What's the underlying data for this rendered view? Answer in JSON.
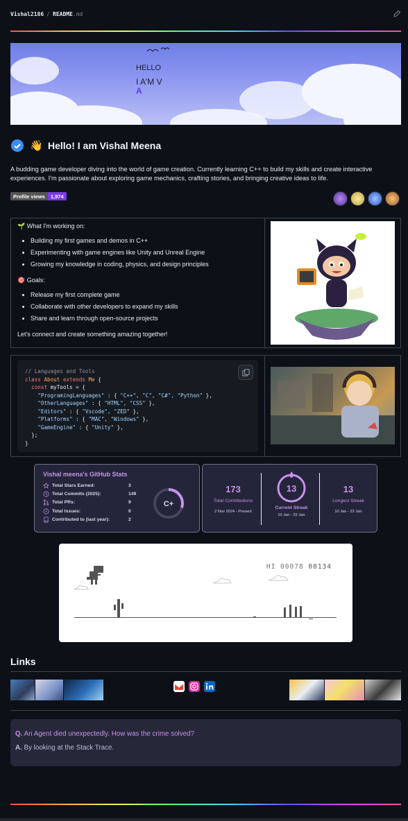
{
  "breadcrumb": {
    "repo": "Vishal2186",
    "separator": "/",
    "file": "README",
    "ext": ".md"
  },
  "banner": {
    "line1": "HELLO",
    "line2": "I A'M V",
    "cursor": "A"
  },
  "greeting": {
    "title": "Hello! I am Vishal Meena"
  },
  "intro": "A budding game developer diving into the world of game creation. Currently learning C++ to build my skills and create interactive experiences. I'm passionate about exploring game mechanics, crafting stories, and bringing creative ideas to life.",
  "profile_views": {
    "label": "Profile views",
    "count": "1,974"
  },
  "working": {
    "heading": "🌱 What I'm working on:",
    "items": [
      "Building my first games and demos in C++",
      "Experimenting with game engines like Unity and Unreal Engine",
      "Growing my knowledge in coding, physics, and design principles"
    ],
    "goals_heading": "🎯 Goals:",
    "goals": [
      "Release my first complete game",
      "Collaborate with other developers to expand my skills",
      "Share and learn through open-source projects"
    ],
    "cta": "Let's connect and create something amazing together!"
  },
  "code": {
    "comment": "// Languages and Tools",
    "kw_class": "class",
    "class_name": "About",
    "kw_extends": "extends",
    "base": "Me",
    "kw_const": "const",
    "var": "myTools",
    "rows": [
      {
        "key": "\"ProgramingLanguages\"",
        "vals": "\"C++\", \"C\", \"C#\", \"Python\""
      },
      {
        "key": "\"OtherLanguages\"",
        "vals": "\"HTML\", \"CSS\""
      },
      {
        "key": "\"Editors\"",
        "vals": "\"Vscode\", \"ZED\""
      },
      {
        "key": "\"Platforms\"",
        "vals": "\"MAC\", \"Windows\""
      },
      {
        "key": "\"GameEngine\"",
        "vals": "\"Unity\""
      }
    ]
  },
  "stats": {
    "title": "Vishal meena's GitHub Stats",
    "rows": [
      {
        "label": "Total Stars Earned:",
        "value": "3"
      },
      {
        "label": "Total Commits (2025):",
        "value": "149"
      },
      {
        "label": "Total PRs:",
        "value": "9"
      },
      {
        "label": "Total Issues:",
        "value": "0"
      },
      {
        "label": "Contributed to (last year):",
        "value": "2"
      }
    ],
    "grade": "C+",
    "grade_progress": 0.3
  },
  "streak": {
    "total": {
      "value": "173",
      "label": "Total Contributions",
      "range": "2 Nov 2024 - Present"
    },
    "current": {
      "value": "13",
      "label": "Current Streak",
      "range": "10 Jan - 22 Jan"
    },
    "longest": {
      "value": "13",
      "label": "Longest Streak",
      "range": "10 Jan - 22 Jan"
    }
  },
  "dino": {
    "hi_label": "HI",
    "hi_score": "00078",
    "score": "00134"
  },
  "links": {
    "title": "Links"
  },
  "joke": {
    "q_prefix": "Q.",
    "question": "An Agent died unexpectedly. How was the crime solved?",
    "a_prefix": "A.",
    "answer": "By looking at the Stack Trace."
  },
  "colors": {
    "accent": "#c792ea",
    "badge": "#7a3ae8",
    "card_bg": "#24253a"
  }
}
